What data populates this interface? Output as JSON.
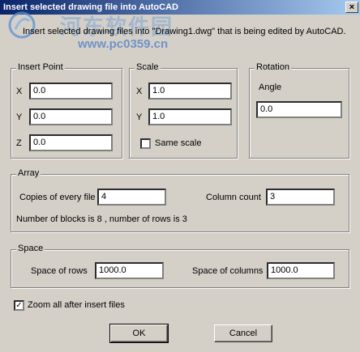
{
  "window": {
    "title": "Insert selected drawing file into AutoCAD",
    "close_glyph": "×"
  },
  "watermark": {
    "site_name": "河东软件园",
    "url": "www.pc0359.cn"
  },
  "description": "Insert selected drawing files into \"Drawing1.dwg\" that is being edited by AutoCAD.",
  "insert_point": {
    "title": "Insert Point",
    "x_label": "X",
    "x_value": "0.0",
    "y_label": "Y",
    "y_value": "0.0",
    "z_label": "Z",
    "z_value": "0.0"
  },
  "scale": {
    "title": "Scale",
    "x_label": "X",
    "x_value": "1.0",
    "y_label": "Y",
    "y_value": "1.0",
    "same_scale_label": "Same scale",
    "same_scale_checked": false
  },
  "rotation": {
    "title": "Rotation",
    "angle_label": "Angle",
    "angle_value": "0.0"
  },
  "array": {
    "title": "Array",
    "copies_label": "Copies of every file",
    "copies_value": "4",
    "column_count_label": "Column count",
    "column_count_value": "3",
    "info": "Number of blocks is 8 , number of rows is 3"
  },
  "space": {
    "title": "Space",
    "rows_label": "Space of rows",
    "rows_value": "1000.0",
    "columns_label": "Space of columns",
    "columns_value": "1000.0"
  },
  "zoom": {
    "label": "Zoom all after insert files",
    "checked": true,
    "check_glyph": "✓"
  },
  "buttons": {
    "ok": "OK",
    "cancel": "Cancel"
  }
}
